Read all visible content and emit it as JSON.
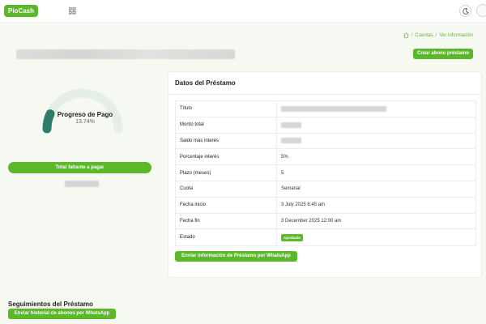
{
  "header": {
    "logo_text": "PioCash",
    "grid_icon": "apps-grid-icon",
    "theme_icon": "moon-icon",
    "avatar_icon": "user-avatar"
  },
  "breadcrumb": {
    "home_icon": "home-icon",
    "items": [
      "Cuentas",
      "Ver información"
    ]
  },
  "actions": {
    "create_payment": "Crear abono préstamo"
  },
  "progress": {
    "title": "Progreso de Pago",
    "percent_text": "13.74%",
    "percent_value": 13.74,
    "remaining_label": "Total faltante a pagar"
  },
  "loan": {
    "title": "Datos del Préstamo",
    "rows": [
      {
        "label": "Título",
        "value": ""
      },
      {
        "label": "Monto total",
        "value": ""
      },
      {
        "label": "Saldo más interés",
        "value": ""
      },
      {
        "label": "Porcentaje interés",
        "value": "5%"
      },
      {
        "label": "Plazo (meses)",
        "value": "5"
      },
      {
        "label": "Cuota",
        "value": "Semanal"
      },
      {
        "label": "Fecha inicio",
        "value": "3 July 2025 6:45 am"
      },
      {
        "label": "Fecha fin",
        "value": "3 December 2025 12:00 am"
      },
      {
        "label": "Estado",
        "value": "Aprobado"
      }
    ],
    "whatsapp_button": "Enviar información de Préstamo por WhatsApp"
  },
  "tracking": {
    "title": "Seguimientos del Préstamo",
    "history_button": "Enviar historial de abonos por WhatsApp"
  },
  "colors": {
    "accent": "#5cb82a",
    "gauge_track": "#e6efe6",
    "gauge_fill": "#2e7d6b"
  }
}
